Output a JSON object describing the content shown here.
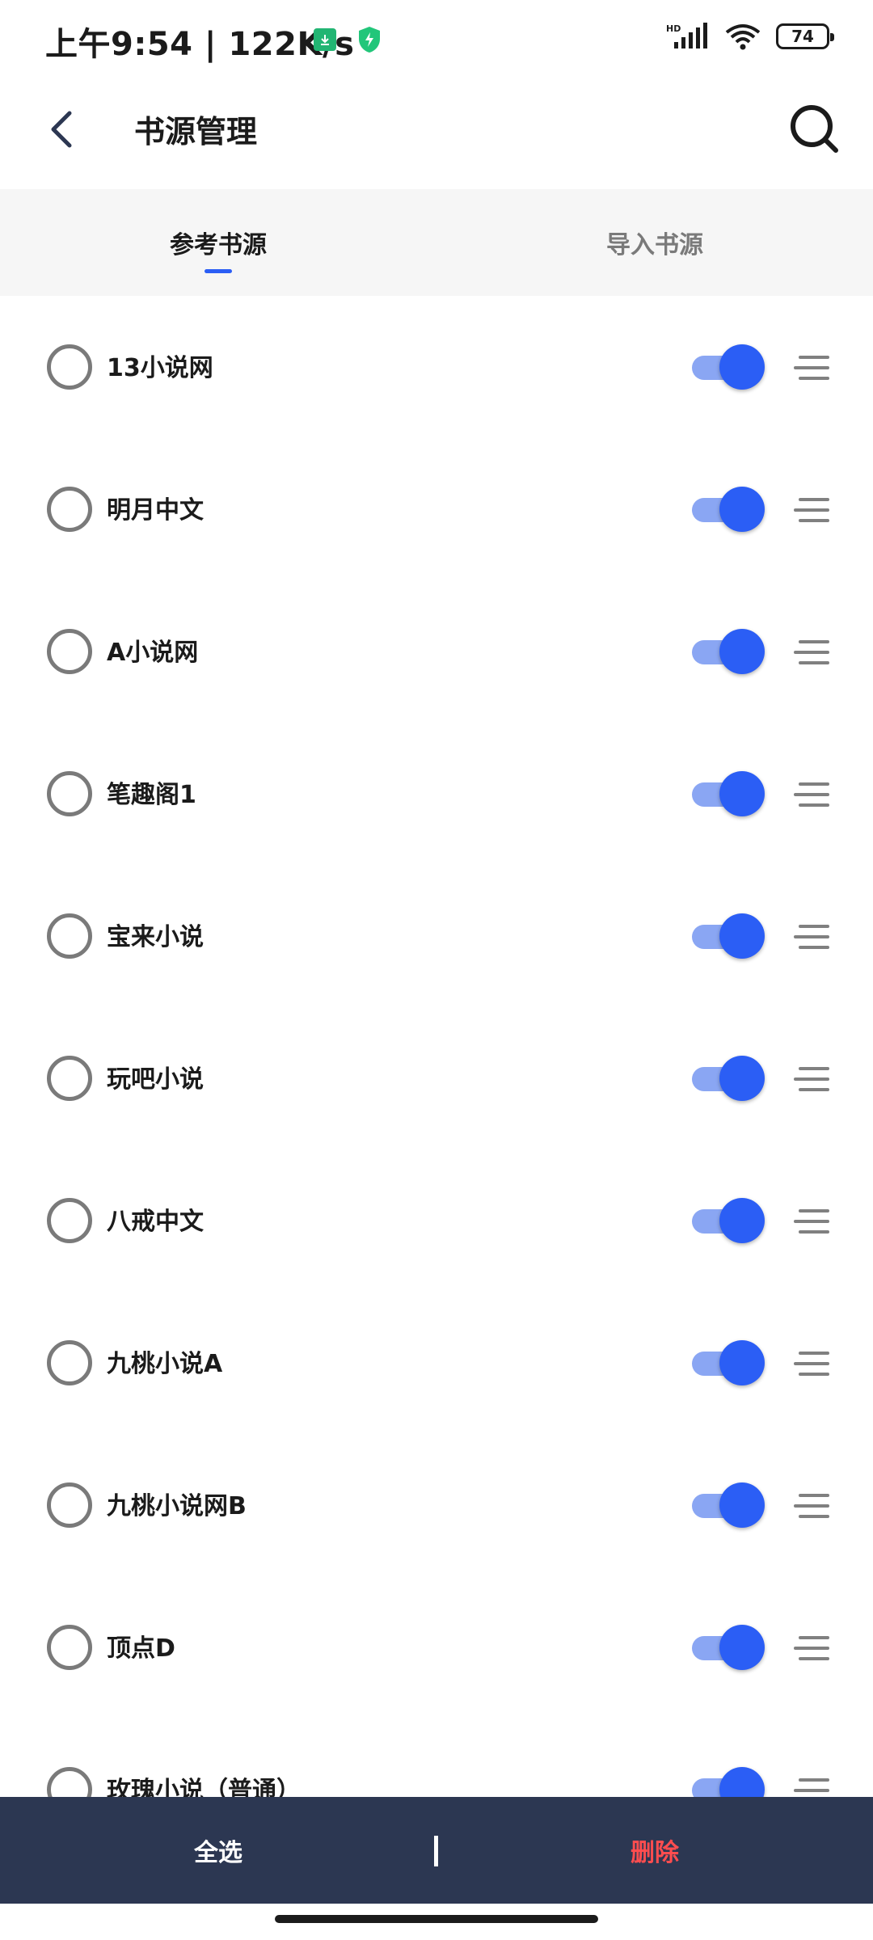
{
  "status_bar": {
    "time": "上午9:54",
    "speed": "122K/s",
    "network": "HD",
    "battery": "74"
  },
  "header": {
    "title": "书源管理"
  },
  "tabs": [
    {
      "label": "参考书源",
      "active": true
    },
    {
      "label": "导入书源",
      "active": false
    }
  ],
  "sources": [
    {
      "name": "13小说网",
      "enabled": true,
      "selected": false
    },
    {
      "name": "明月中文",
      "enabled": true,
      "selected": false
    },
    {
      "name": "A小说网",
      "enabled": true,
      "selected": false
    },
    {
      "name": "笔趣阁1",
      "enabled": true,
      "selected": false
    },
    {
      "name": "宝来小说",
      "enabled": true,
      "selected": false
    },
    {
      "name": "玩吧小说",
      "enabled": true,
      "selected": false
    },
    {
      "name": "八戒中文",
      "enabled": true,
      "selected": false
    },
    {
      "name": "九桃小说A",
      "enabled": true,
      "selected": false
    },
    {
      "name": "九桃小说网B",
      "enabled": true,
      "selected": false
    },
    {
      "name": "顶点D",
      "enabled": true,
      "selected": false
    },
    {
      "name": "玫瑰小说（普通）",
      "enabled": true,
      "selected": false
    }
  ],
  "bottom_bar": {
    "select_all": "全选",
    "delete": "删除"
  },
  "colors": {
    "accent": "#2b5ef5",
    "bottom_bar": "#2c3752",
    "delete": "#ff4d4f"
  }
}
